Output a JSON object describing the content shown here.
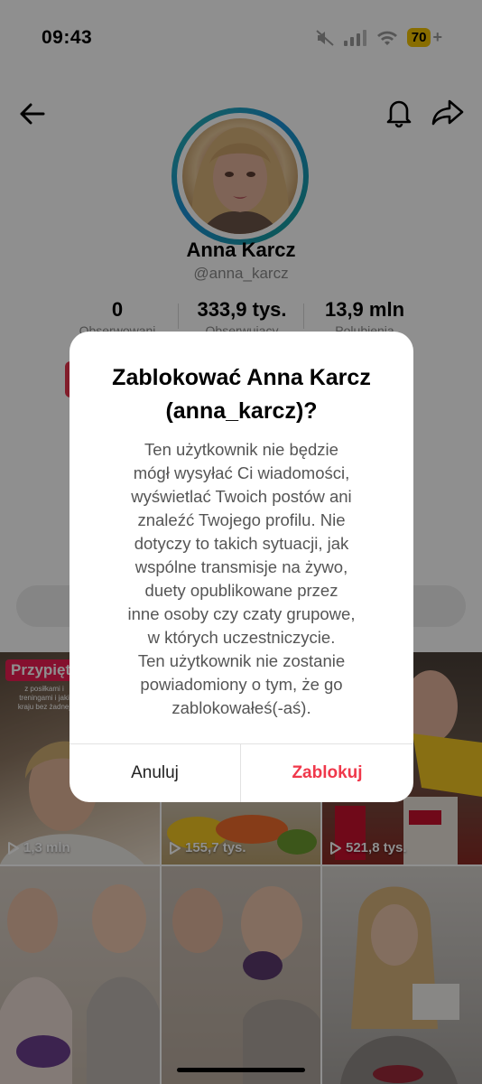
{
  "status_bar": {
    "time": "09:43",
    "battery": "70",
    "battery_plus": "+"
  },
  "profile": {
    "name": "Anna Karcz",
    "handle": "@anna_karcz",
    "stats": [
      {
        "value": "0",
        "label": "Obserwowani"
      },
      {
        "value": "333,9 tys.",
        "label": "Obserwujący"
      },
      {
        "value": "13,9 mln",
        "label": "Polubienia"
      }
    ]
  },
  "grid": {
    "pinned_label": "Przypięte",
    "pinned_text": "z posiłkami i treningami i jaki kraju bez żadnej",
    "tiles": [
      {
        "views": "1,3 mln"
      },
      {
        "views": "155,7 tys."
      },
      {
        "views": "521,8 tys."
      },
      {
        "views": ""
      },
      {
        "views": ""
      },
      {
        "views": ""
      }
    ]
  },
  "dialog": {
    "title": "Zablokować Anna Karcz\n(anna_karcz)?",
    "body": "Ten użytkownik nie będzie\nmógł wysyłać Ci wiadomości,\nwyświetlać Twoich postów ani\nznaleźć Twojego profilu. Nie\ndotyczy to takich sytuacji, jak\nwspólne transmisje na żywo,\nduety opublikowane przez\ninne osoby czy czaty grupowe,\nw których uczestniczycie.\nTen użytkownik nie zostanie\npowiadomiony o tym, że go\nzablokowałeś(-aś).",
    "cancel_label": "Anuluj",
    "block_label": "Zablokuj"
  },
  "colors": {
    "accent": "#f0384b",
    "overlay": "rgba(0,0,0,0.44)",
    "battery": "#f2c200"
  },
  "icons": [
    "back-arrow-icon",
    "bell-icon",
    "share-icon",
    "mute-icon",
    "signal-icon",
    "wifi-icon",
    "play-icon"
  ]
}
